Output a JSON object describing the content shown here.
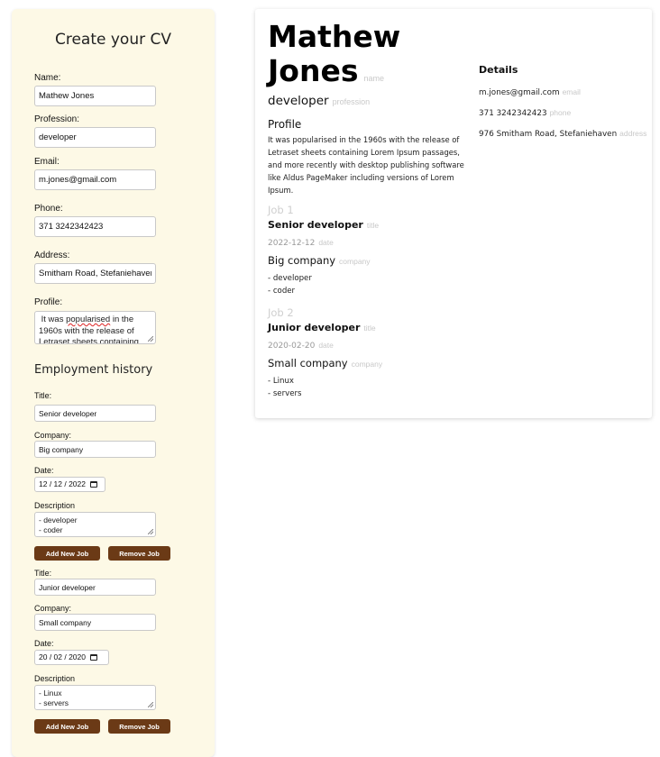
{
  "form": {
    "title": "Create your CV",
    "name_label": "Name:",
    "name_value": "Mathew Jones",
    "profession_label": "Profession:",
    "profession_value": "developer",
    "email_label": "Email:",
    "email_value": "m.jones@gmail.com",
    "phone_label": "Phone:",
    "phone_value": "371 3242342423",
    "address_label": "Address:",
    "address_value": "Smitham Road, Stefaniehaven",
    "profile_label": "Profile:",
    "profile_value_pre": " It was ",
    "profile_value_misspelled": "popularised",
    "profile_value_post": " in the 1960s with the release of Letraset sheets containing",
    "employment_title": "Employment history",
    "jobs": [
      {
        "title_label": "Title:",
        "title_value": "Senior developer",
        "company_label": "Company:",
        "company_value": "Big company",
        "date_label": "Date:",
        "date_value": "12 / 12 / 2022",
        "description_label": "Description",
        "description_value": "- developer\n- coder",
        "add_button": "Add New Job",
        "remove_button": "Remove Job"
      },
      {
        "title_label": "Title:",
        "title_value": "Junior developer",
        "company_label": "Company:",
        "company_value": "Small company",
        "date_label": "Date:",
        "date_value": "20 / 02 / 2020",
        "description_label": "Description",
        "description_value": "- Linux\n- servers",
        "add_button": "Add New Job",
        "remove_button": "Remove Job"
      }
    ]
  },
  "cv": {
    "name_line1": "Mathew",
    "name_line2": "Jones",
    "name_tag": "name",
    "profession": "developer",
    "profession_tag": "profession",
    "profile_heading": "Profile",
    "profile_text": "It was popularised in the 1960s with the release of Letraset sheets containing Lorem Ipsum passages, and more recently with desktop publishing software like Aldus PageMaker including versions of Lorem Ipsum.",
    "jobs": [
      {
        "heading": "Job 1",
        "title": "Senior developer",
        "title_tag": "title",
        "date": "2022-12-12",
        "date_tag": "date",
        "company": "Big company",
        "company_tag": "company",
        "description": "- developer\n- coder"
      },
      {
        "heading": "Job 2",
        "title": "Junior developer",
        "title_tag": "title",
        "date": "2020-02-20",
        "date_tag": "date",
        "company": "Small company",
        "company_tag": "company",
        "description": "- Linux\n- servers"
      }
    ],
    "details_heading": "Details",
    "email": "m.jones@gmail.com",
    "email_tag": "email",
    "phone": "371 3242342423",
    "phone_tag": "phone",
    "address": "976 Smitham Road, Stefaniehaven",
    "address_tag": "address"
  },
  "colors": {
    "panel_bg": "#fdf9e6",
    "button_bg": "#6b3a16",
    "tag_text": "#c8c8c8"
  },
  "icons": [
    "calendar-icon",
    "resize-grip-icon"
  ]
}
